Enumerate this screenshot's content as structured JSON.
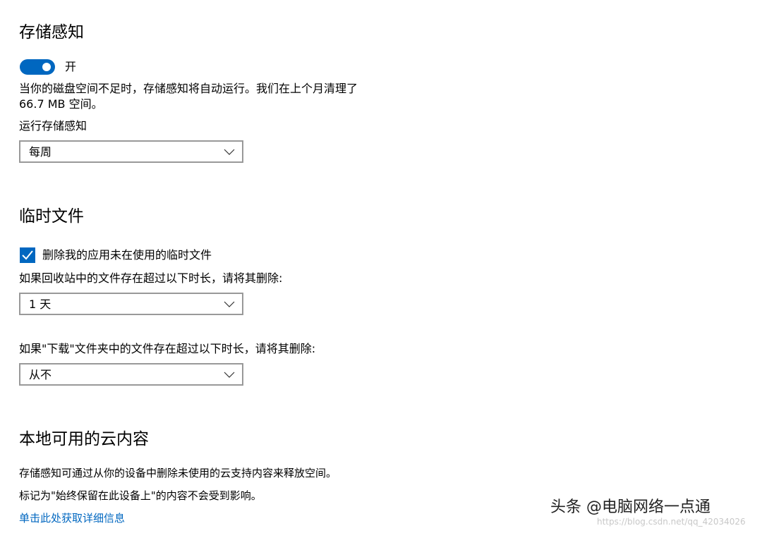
{
  "storage_sense": {
    "title": "存储感知",
    "toggle_label": "开",
    "toggle_on": true,
    "description_line1": "当你的磁盘空间不足时，存储感知将自动运行。我们在上个月清理了",
    "description_line2": "66.7 MB 空间。",
    "run_label": "运行存储感知",
    "run_value": "每周"
  },
  "temp_files": {
    "title": "临时文件",
    "checkbox_label": "删除我的应用未在使用的临时文件",
    "checkbox_checked": true,
    "recycle_label": "如果回收站中的文件存在超过以下时长，请将其删除:",
    "recycle_value": "1 天",
    "downloads_label": "如果\"下载\"文件夹中的文件存在超过以下时长，请将其删除:",
    "downloads_value": "从不"
  },
  "cloud_content": {
    "title": "本地可用的云内容",
    "line1": "存储感知可通过从你的设备中删除未使用的云支持内容来释放空间。",
    "line2": "标记为\"始终保留在此设备上\"的内容不会受到影响。",
    "details_link": "单击此处获取详细信息"
  },
  "watermark": {
    "brand": "头条 @电脑网络一点通",
    "url": "https://blog.csdn.net/qq_42034026"
  },
  "colors": {
    "accent": "#0067c0",
    "combo_border": "#999999"
  }
}
